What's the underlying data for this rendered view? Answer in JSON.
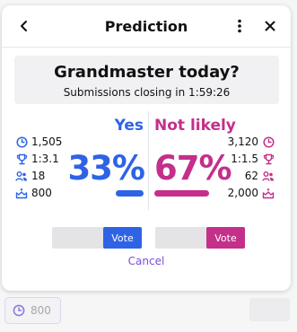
{
  "header": {
    "title": "Prediction"
  },
  "question": {
    "text": "Grandmaster today?",
    "closing": "Submissions closing in 1:59:26"
  },
  "yes": {
    "label": "Yes",
    "percent": "33%",
    "percent_value": 0.33,
    "color": "#2e63e6",
    "stats": [
      {
        "icon": "clock-icon",
        "value": "1,505"
      },
      {
        "icon": "trophy-icon",
        "value": "1:3.1"
      },
      {
        "icon": "users-icon",
        "value": "18"
      },
      {
        "icon": "points-icon",
        "value": "800"
      }
    ],
    "vote_label": "Vote"
  },
  "no": {
    "label": "Not likely",
    "percent": "67%",
    "percent_value": 0.67,
    "color": "#c42f8a",
    "stats": [
      {
        "icon": "clock-icon",
        "value": "3,120"
      },
      {
        "icon": "trophy-icon",
        "value": "1:1.5"
      },
      {
        "icon": "users-icon",
        "value": "62"
      },
      {
        "icon": "points-icon",
        "value": "2,000"
      }
    ],
    "vote_label": "Vote"
  },
  "cancel_label": "Cancel",
  "chip": {
    "icon": "clock-icon",
    "value": "800"
  },
  "colors": {
    "accent_link": "#7a4fd8",
    "chip_icon": "#8a7fd8"
  }
}
